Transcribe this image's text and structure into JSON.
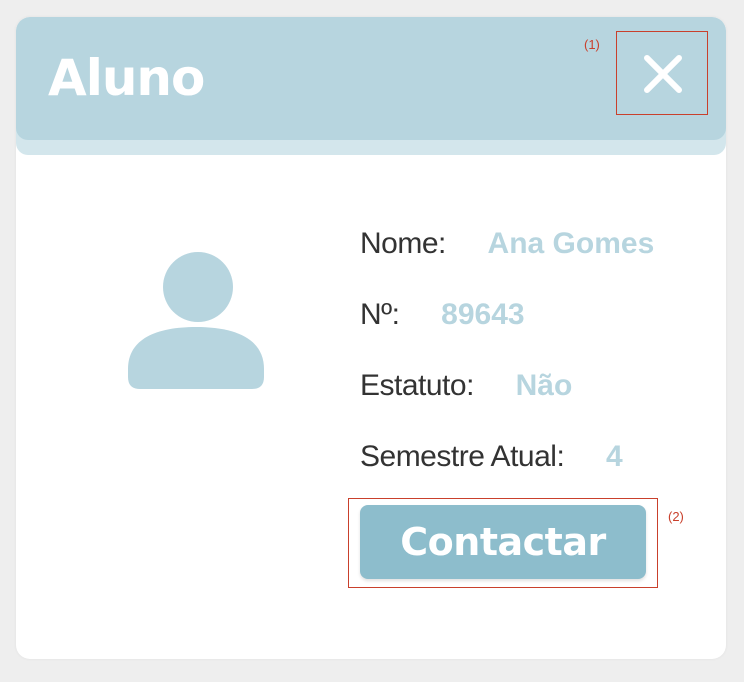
{
  "dialog": {
    "title": "Aluno",
    "close_marker": "(1)",
    "contact_marker": "(2)"
  },
  "fields": {
    "nome_label": "Nome:",
    "nome_value": "Ana Gomes",
    "numero_label": "Nº:",
    "numero_value": "89643",
    "estatuto_label": "Estatuto:",
    "estatuto_value": "Não",
    "semestre_label": "Semestre Atual:",
    "semestre_value": "4"
  },
  "actions": {
    "contact_label": "Contactar"
  },
  "colors": {
    "header": "#b7d5df",
    "accent": "#8dbdcc",
    "annotation": "#c9402c"
  },
  "icons": {
    "close": "close-icon",
    "avatar": "user-avatar-icon"
  }
}
